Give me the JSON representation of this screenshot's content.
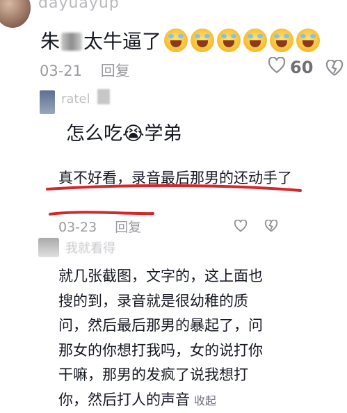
{
  "comments": [
    {
      "username": "dayuayup",
      "text_before": "朱",
      "text_after": "太牛逼了",
      "emoji_count": 6,
      "date": "03-21",
      "reply_label": "回复",
      "likes": "60"
    },
    {
      "username": "ratel",
      "text": "怎么吃😭学弟"
    },
    {
      "text": "真不好看，录音最后那男的还动手了",
      "date": "03-23",
      "reply_label": "回复"
    },
    {
      "username": "我就看得",
      "text": "就几张截图，文字的，这上面也搜的到，录音就是很幼稚的质问，然后最后那男的暴起了，问那女的你想打我吗，女的说打你干嘛，那男的发疯了说我想打你，然后打人的声音",
      "collapse_label": "收起"
    }
  ],
  "colors": {
    "annotation_red": "#d8252a",
    "meta_gray": "#9a9aa0"
  }
}
